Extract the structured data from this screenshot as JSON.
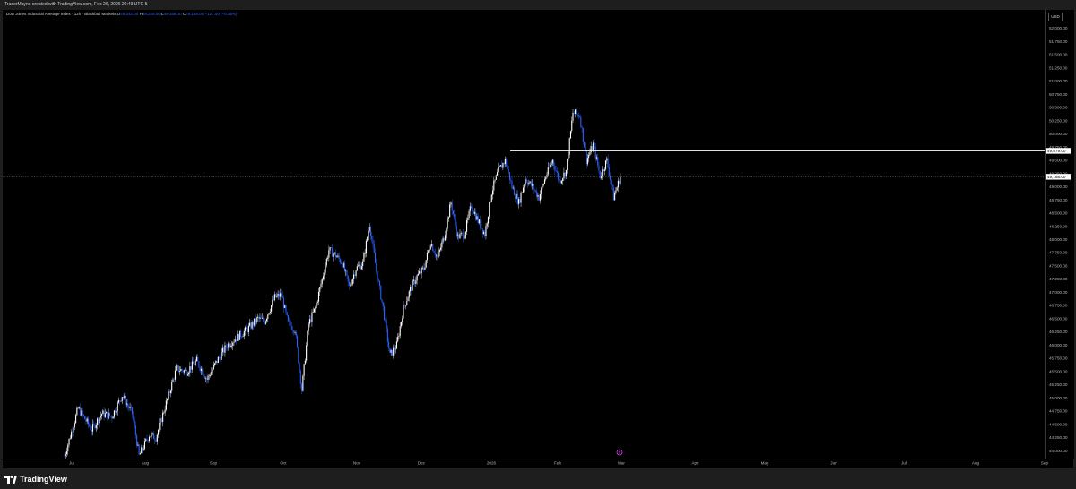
{
  "header": {
    "credit": "TraderMayne created with TradingView.com, Feb 26, 2026 20:49 UTC-5"
  },
  "legend": {
    "symbol": "Dow Jones Industrial Average Index · 12h · Blackbull Markets",
    "open_key": "O",
    "open_value": "49,242.00",
    "high_key": "H",
    "high_value": "49,246.00",
    "low_key": "L",
    "low_value": "49,156.00",
    "close_key": "C",
    "close_value": "49,188.00",
    "change": "−121.00 (−0.25%)"
  },
  "axis": {
    "currency": "USD"
  },
  "footer": {
    "brand": "TradingView"
  },
  "colors": {
    "background": "#000000",
    "up_candle": "#ffffff",
    "down_candle": "#2962ff",
    "horizontal_line": "#ffffff",
    "price_dotted": "#808080",
    "marker": "#e040fb"
  },
  "chart_data": {
    "type": "candlestick",
    "title": "Dow Jones Industrial Average Index · 12h · Blackbull Markets",
    "currency": "USD",
    "ylim": [
      43850,
      52350
    ],
    "y_ticks": [
      44000,
      44250,
      44500,
      44750,
      45000,
      45250,
      45500,
      45750,
      46000,
      46250,
      46500,
      46750,
      47000,
      47250,
      47500,
      47750,
      48000,
      48250,
      48500,
      48750,
      49000,
      49250,
      49500,
      49750,
      50000,
      50250,
      50500,
      50750,
      51000,
      51250,
      51500,
      51750,
      52000,
      52250
    ],
    "y_tick_labels": [
      "44,000.00",
      "44,250.00",
      "44,500.00",
      "44,750.00",
      "45,000.00",
      "45,250.00",
      "45,500.00",
      "45,750.00",
      "46,000.00",
      "46,250.00",
      "46,500.00",
      "46,750.00",
      "47,000.00",
      "47,250.00",
      "47,500.00",
      "47,750.00",
      "48,000.00",
      "48,250.00",
      "48,500.00",
      "48,750.00",
      "49,000.00",
      "49,250.00",
      "49,500.00",
      "49,750.00",
      "50,000.00",
      "50,250.00",
      "50,500.00",
      "50,750.00",
      "51,000.00",
      "51,250.00",
      "51,500.00",
      "51,750.00",
      "52,000.00",
      "52,250.00"
    ],
    "x_labels": [
      "Jul",
      "Aug",
      "Sep",
      "Oct",
      "Nov",
      "Dec",
      "2026",
      "Feb",
      "Mar",
      "Apr",
      "May",
      "Jun",
      "Jul",
      "Aug",
      "Sep"
    ],
    "price_path": [
      [
        0,
        43900
      ],
      [
        4,
        44800
      ],
      [
        8,
        44400
      ],
      [
        11,
        44700
      ],
      [
        14,
        44650
      ],
      [
        17,
        45050
      ],
      [
        20,
        44700
      ],
      [
        22,
        43900
      ],
      [
        25,
        44300
      ],
      [
        27,
        44250
      ],
      [
        30,
        44900
      ],
      [
        33,
        45550
      ],
      [
        36,
        45500
      ],
      [
        39,
        45700
      ],
      [
        42,
        45350
      ],
      [
        45,
        45700
      ],
      [
        48,
        46000
      ],
      [
        51,
        46150
      ],
      [
        54,
        46300
      ],
      [
        57,
        46500
      ],
      [
        59,
        46450
      ],
      [
        62,
        46900
      ],
      [
        64,
        46950
      ],
      [
        66,
        46400
      ],
      [
        68,
        46300
      ],
      [
        70,
        45150
      ],
      [
        72,
        46400
      ],
      [
        74,
        46700
      ],
      [
        76,
        47250
      ],
      [
        78,
        47800
      ],
      [
        80,
        47700
      ],
      [
        82,
        47550
      ],
      [
        84,
        47100
      ],
      [
        86,
        47450
      ],
      [
        88,
        47550
      ],
      [
        90,
        48300
      ],
      [
        92,
        47400
      ],
      [
        94,
        46700
      ],
      [
        96,
        45800
      ],
      [
        98,
        46000
      ],
      [
        100,
        46700
      ],
      [
        102,
        47050
      ],
      [
        104,
        47300
      ],
      [
        106,
        47450
      ],
      [
        108,
        47950
      ],
      [
        110,
        47650
      ],
      [
        112,
        48050
      ],
      [
        114,
        48700
      ],
      [
        116,
        48050
      ],
      [
        118,
        48100
      ],
      [
        120,
        48650
      ],
      [
        122,
        48350
      ],
      [
        124,
        48100
      ],
      [
        126,
        48900
      ],
      [
        128,
        49300
      ],
      [
        130,
        49500
      ],
      [
        132,
        49000
      ],
      [
        134,
        48700
      ],
      [
        136,
        49150
      ],
      [
        138,
        49000
      ],
      [
        140,
        48800
      ],
      [
        142,
        49200
      ],
      [
        144,
        49500
      ],
      [
        146,
        49100
      ],
      [
        148,
        49300
      ],
      [
        150,
        50400
      ],
      [
        152,
        50350
      ],
      [
        154,
        49500
      ],
      [
        156,
        49800
      ],
      [
        158,
        49200
      ],
      [
        160,
        49500
      ],
      [
        162,
        48800
      ],
      [
        164,
        49188
      ]
    ],
    "horizontal_line": {
      "price": 49679,
      "label": "49,679.00"
    },
    "last_price": {
      "price": 49188,
      "label": "49,188.00"
    },
    "marker_label": "$"
  }
}
